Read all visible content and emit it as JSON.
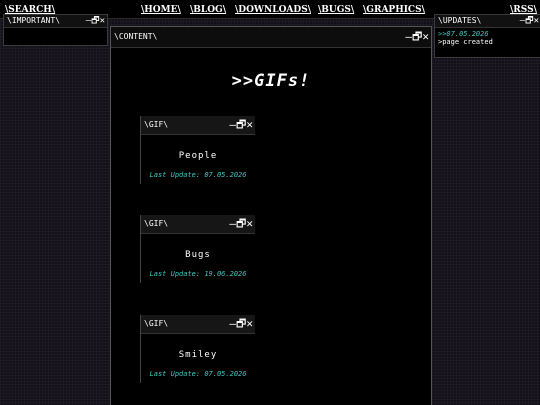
{
  "nav": {
    "search": "\\SEARCH\\",
    "home": "\\HOME\\",
    "blog": "\\BLOG\\",
    "downloads": "\\DOWNLOADS\\",
    "bugs": "\\BUGS\\",
    "graphics": "\\GRAPHICS\\",
    "rss": "\\RSS\\"
  },
  "left_window": {
    "title": "\\IMPORTANT\\"
  },
  "right_window": {
    "title": "\\UPDATES\\",
    "date": ">>07.05.2026",
    "entry": ">page created"
  },
  "content_window": {
    "title": "\\CONTENT\\",
    "heading": ">>GIFs!",
    "cards": [
      {
        "title": "\\GIF\\",
        "name": "People",
        "update": "Last Update: 07.05.2026"
      },
      {
        "title": "\\GIF\\",
        "name": "Bugs",
        "update": "Last Update: 19.06.2026"
      },
      {
        "title": "\\GIF\\",
        "name": "Smiley",
        "update": "Last Update: 07.05.2026"
      }
    ]
  },
  "controls": {
    "minimize": "—",
    "restore": "🗗",
    "close": "✕"
  },
  "colors": {
    "accent": "#3ec6c0",
    "background": "#14101a"
  }
}
